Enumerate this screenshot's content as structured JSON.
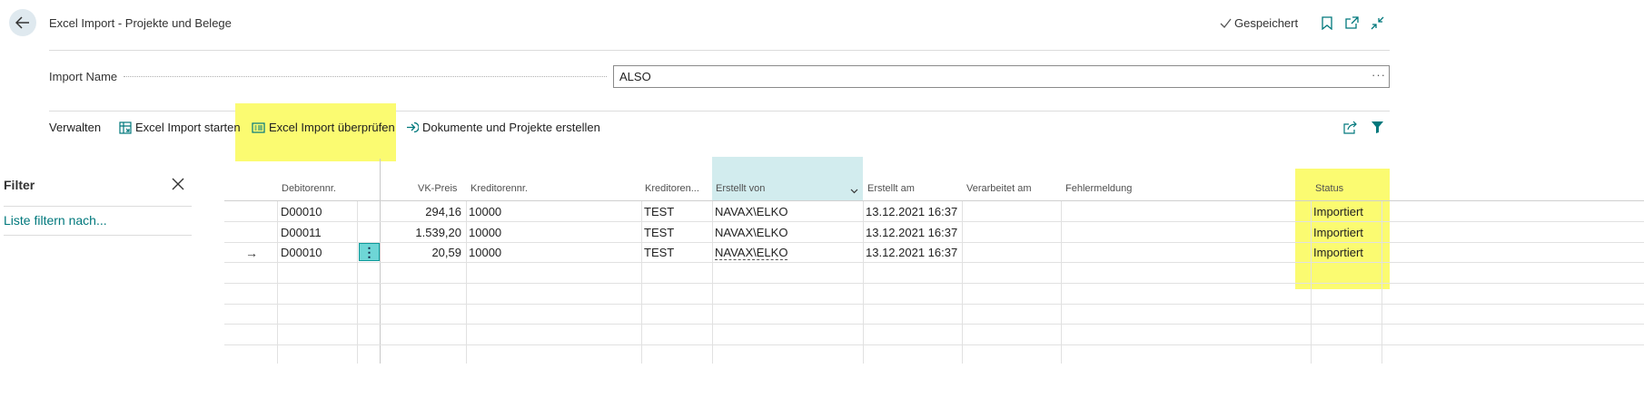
{
  "header": {
    "title": "Excel Import - Projekte und Belege",
    "saved_label": "Gespeichert",
    "icons": [
      "back-arrow-icon",
      "checkmark-icon",
      "bookmark-icon",
      "open-in-new-window-icon",
      "collapse-icon"
    ]
  },
  "import_name": {
    "label": "Import Name",
    "value": "ALSO",
    "more": "···"
  },
  "actions": {
    "manage": "Verwalten",
    "start": "Excel Import starten",
    "check": "Excel Import überprüfen",
    "create": "Dokumente und Projekte erstellen"
  },
  "filter": {
    "title": "Filter",
    "link": "Liste filtern nach..."
  },
  "table": {
    "columns": {
      "debitor": "Debitorennr.",
      "vk": "VK-Preis",
      "kreditor": "Kreditorennr.",
      "kreditor_name": "Kreditoren...",
      "erstellt_von": "Erstellt von",
      "erstellt_am": "Erstellt am",
      "verarbeitet": "Verarbeitet am",
      "fehler": "Fehlermeldung",
      "status": "Status"
    },
    "rows": [
      {
        "debitor": "D00010",
        "vk": "294,16",
        "kreditor": "10000",
        "kreditor_name": "TEST",
        "erstellt_von": "NAVAX\\ELKO",
        "erstellt_am": "13.12.2021 16:37",
        "status": "Importiert"
      },
      {
        "debitor": "D00011",
        "vk": "1.539,20",
        "kreditor": "10000",
        "kreditor_name": "TEST",
        "erstellt_von": "NAVAX\\ELKO",
        "erstellt_am": "13.12.2021 16:37",
        "status": "Importiert"
      },
      {
        "debitor": "D00010",
        "vk": "20,59",
        "kreditor": "10000",
        "kreditor_name": "TEST",
        "erstellt_von": "NAVAX\\ELKO",
        "erstellt_am": "13.12.2021 16:37",
        "status": "Importiert"
      }
    ],
    "current_row_marker": "→",
    "row_menu": "⋮"
  },
  "colors": {
    "highlight": "#fbfb71",
    "accent": "#00787c",
    "selected_column": "#d2ecee"
  }
}
